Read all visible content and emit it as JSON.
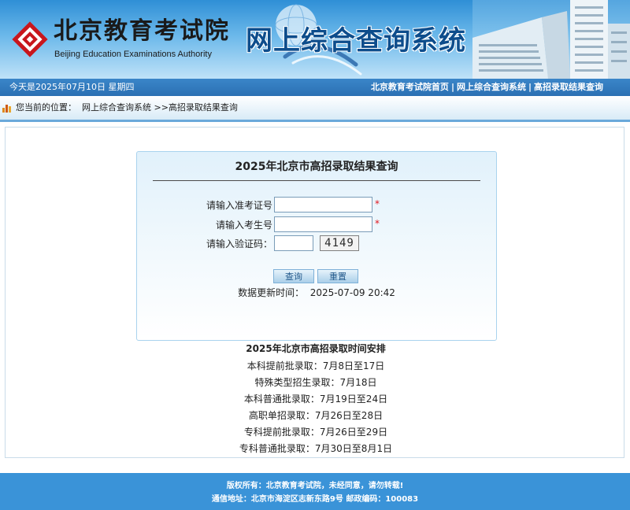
{
  "header": {
    "org_name_cn": "北京教育考试院",
    "org_name_en": "Beijing Education Examinations Authority",
    "system_title": "网上综合查询系统"
  },
  "navbar": {
    "date_text": "今天是2025年07月10日  星期四",
    "links": [
      {
        "label": "北京教育考试院首页"
      },
      {
        "label": "网上综合查询系统"
      },
      {
        "label": "高招录取结果查询"
      }
    ],
    "separator": "|"
  },
  "breadcrumb": {
    "prefix": "您当前的位置：",
    "item1": "网上综合查询系统",
    "item2": ">>高招录取结果查询"
  },
  "query": {
    "title": "2025年北京市高招录取结果查询",
    "fields": [
      {
        "label": "请输入准考证号",
        "value": "",
        "required_mark": "*"
      },
      {
        "label": "请输入考生号",
        "value": "",
        "required_mark": "*"
      },
      {
        "label": "请输入验证码：",
        "value": ""
      }
    ],
    "captcha_text": "4149",
    "submit_label": "查询",
    "reset_label": "重置",
    "updated_label": "数据更新时间：",
    "updated_value": "2025-07-09 20:42"
  },
  "schedule": {
    "title": "2025年北京市高招录取时间安排",
    "items": [
      "本科提前批录取：7月8日至17日",
      "特殊类型招生录取：7月18日",
      "本科普通批录取：7月19日至24日",
      "高职单招录取：7月26日至28日",
      "专科提前批录取：7月26日至29日",
      "专科普通批录取：7月30日至8月1日"
    ]
  },
  "footer": {
    "copyright": "版权所有：北京教育考试院，未经同意，请勿转载!",
    "address": "通信地址：北京市海淀区志新东路9号  邮政编码：100083"
  },
  "colors": {
    "navbar": "#2b70b3",
    "footer": "#3a93d8",
    "required": "#e0161e",
    "title_blue": "#0d4d8c"
  }
}
